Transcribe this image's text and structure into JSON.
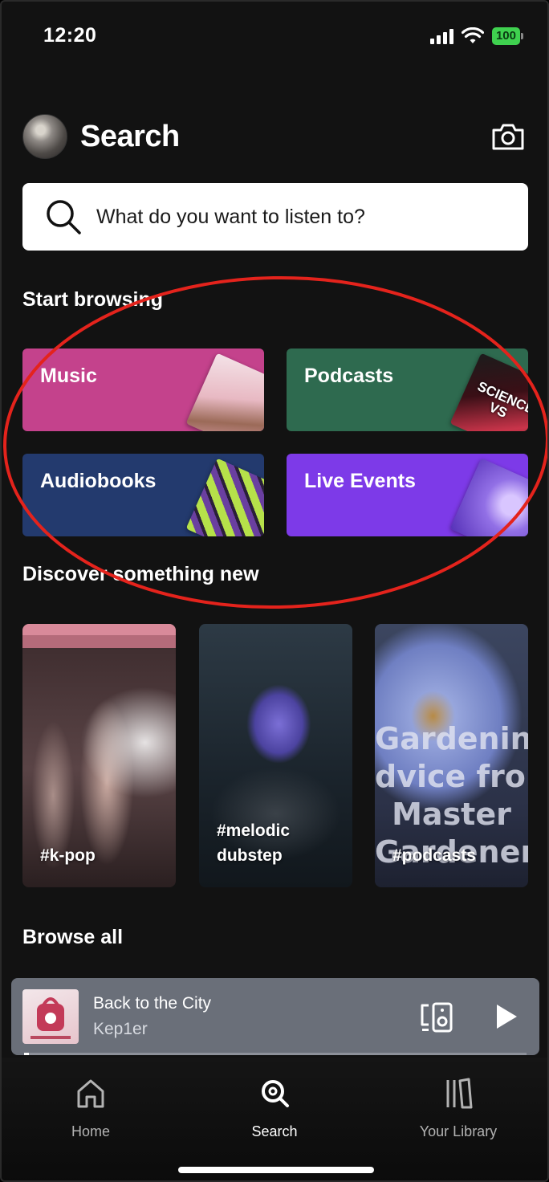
{
  "status_bar": {
    "time": "12:20",
    "battery": "100"
  },
  "header": {
    "title": "Search"
  },
  "search": {
    "placeholder": "What do you want to listen to?"
  },
  "start_browsing": {
    "heading": "Start browsing",
    "tiles": [
      {
        "label": "Music",
        "color": "#c4428c"
      },
      {
        "label": "Podcasts",
        "color": "#2e6a4f",
        "art_text": "SCIENCE VS"
      },
      {
        "label": "Audiobooks",
        "color": "#233a6e"
      },
      {
        "label": "Live Events",
        "color": "#7d3ae8"
      }
    ]
  },
  "discover": {
    "heading": "Discover something new",
    "cards": [
      {
        "label": "#k-pop"
      },
      {
        "label_line1": "#melodic",
        "label_line2": "dubstep"
      },
      {
        "label": "#podcasts",
        "art_text": [
          "Gardening",
          "dvice from",
          "Master",
          "Gardener"
        ]
      }
    ]
  },
  "browse_all": {
    "heading": "Browse all"
  },
  "now_playing": {
    "title": "Back to the City",
    "artist": "Kep1er",
    "progress": 0.01
  },
  "nav": {
    "items": [
      {
        "label": "Home",
        "active": false
      },
      {
        "label": "Search",
        "active": true
      },
      {
        "label": "Your Library",
        "active": false
      }
    ]
  },
  "colors": {
    "background": "#121212",
    "accent": "#1db954",
    "annotation": "#e4231c"
  }
}
